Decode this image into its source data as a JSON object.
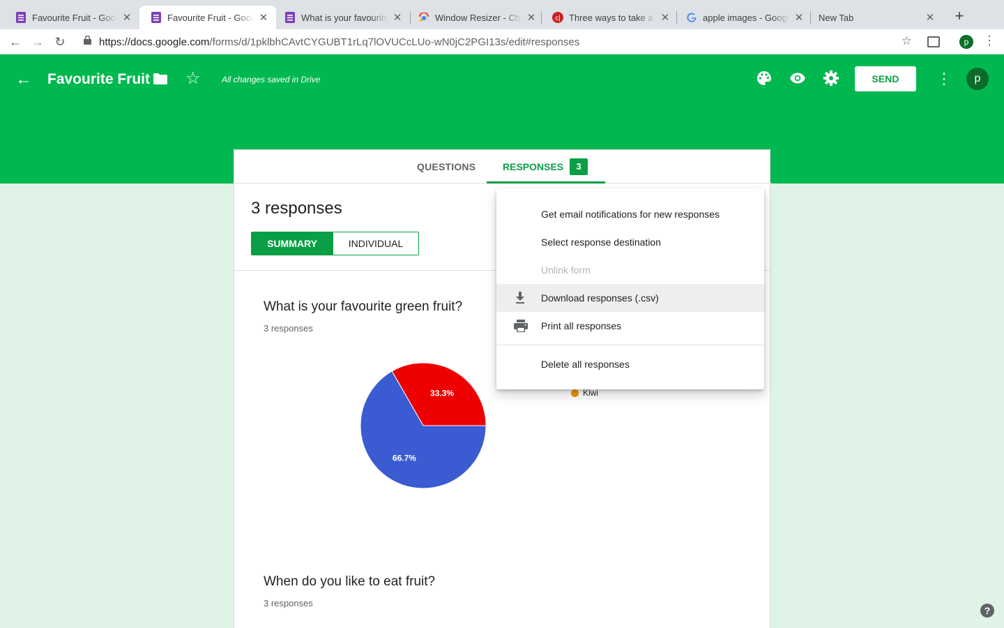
{
  "browser": {
    "tabs": [
      {
        "title": "Favourite Fruit - Google Forms",
        "favicon": "forms-icon"
      },
      {
        "title": "Favourite Fruit - Google Forms",
        "favicon": "forms-icon"
      },
      {
        "title": "What is your favourite fruit",
        "favicon": "forms-icon"
      },
      {
        "title": "Window Resizer - Chrome",
        "favicon": "chrome-store-icon"
      },
      {
        "title": "Three ways to take a screenshot",
        "favicon": "site-c-icon"
      },
      {
        "title": "apple images - Google Search",
        "favicon": "google-icon"
      },
      {
        "title": "New Tab",
        "favicon": ""
      }
    ],
    "url_host": "https://docs.google.com",
    "url_path": "/forms/d/1pklbhCAvtCYGUBT1rLq7lOVUCcLUo-wN0jC2PGI13s/edit#responses",
    "profile_initial": "p"
  },
  "header": {
    "title": "Favourite Fruit",
    "saved_status": "All changes saved in Drive",
    "send_label": "SEND",
    "avatar_initial": "p",
    "accent_color": "#00b84f"
  },
  "form_tabs": {
    "questions_label": "QUESTIONS",
    "responses_label": "RESPONSES",
    "responses_count": "3"
  },
  "summary": {
    "response_count_label": "3 responses",
    "summary_label": "SUMMARY",
    "individual_label": "INDIVIDUAL"
  },
  "questions": [
    {
      "title": "What is your favourite green fruit?",
      "responses": "3 responses"
    },
    {
      "title": "When do you like to eat fruit?",
      "responses": "3 responses"
    }
  ],
  "chart_data": {
    "type": "pie",
    "title": "",
    "slices": [
      {
        "label": "",
        "value": 33.3,
        "display": "33.3%",
        "color": "#ee0000"
      },
      {
        "label": "",
        "value": 66.7,
        "display": "66.7%",
        "color": "#3a5bd1"
      }
    ],
    "legend": [
      {
        "label": "Kiwi",
        "color": "#f09300"
      }
    ],
    "legend_placement": "right"
  },
  "responses_menu": {
    "items": [
      {
        "label": "Get email notifications for new responses",
        "icon": "",
        "disabled": false
      },
      {
        "label": "Select response destination",
        "icon": "",
        "disabled": false
      },
      {
        "label": "Unlink form",
        "icon": "",
        "disabled": true
      },
      {
        "label": "Download responses (.csv)",
        "icon": "download-icon",
        "disabled": false
      },
      {
        "label": "Print all responses",
        "icon": "print-icon",
        "disabled": false
      },
      {
        "label": "Delete all responses",
        "icon": "",
        "disabled": false
      }
    ]
  },
  "help_label": "?"
}
